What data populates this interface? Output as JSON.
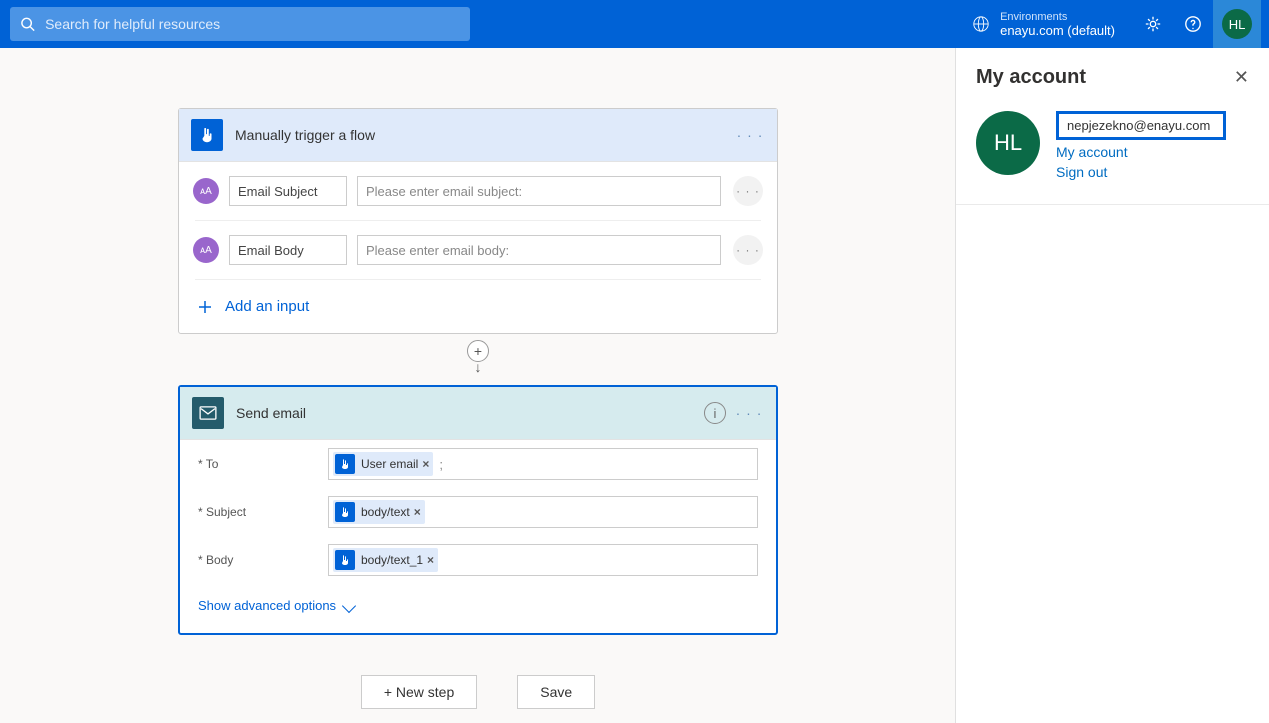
{
  "search": {
    "placeholder": "Search for helpful resources"
  },
  "environment": {
    "label": "Environments",
    "name": "enayu.com (default)"
  },
  "user": {
    "initials": "HL"
  },
  "trigger": {
    "title": "Manually trigger a flow",
    "inputs": [
      {
        "name": "Email Subject",
        "placeholder": "Please enter email subject:"
      },
      {
        "name": "Email Body",
        "placeholder": "Please enter email body:"
      }
    ],
    "addInput": "Add an input"
  },
  "action": {
    "title": "Send email",
    "fields": [
      {
        "label": "* To",
        "tokens": [
          "User email"
        ],
        "suffix": ";"
      },
      {
        "label": "* Subject",
        "tokens": [
          "body/text"
        ],
        "suffix": ""
      },
      {
        "label": "* Body",
        "tokens": [
          "body/text_1"
        ],
        "suffix": ""
      }
    ],
    "advanced": "Show advanced options"
  },
  "buttons": {
    "newStep": "+ New step",
    "save": "Save"
  },
  "panel": {
    "title": "My account",
    "email": "nepjezekno@enayu.com",
    "links": [
      "My account",
      "Sign out"
    ]
  }
}
